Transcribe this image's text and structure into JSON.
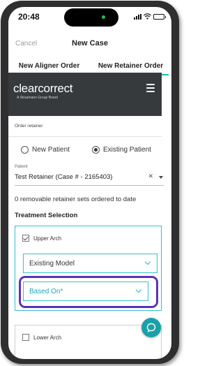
{
  "status_bar": {
    "time": "20:48",
    "icons": [
      "signal-icon",
      "wifi-icon",
      "battery-icon"
    ]
  },
  "nav": {
    "cancel_label": "Cancel",
    "title": "New Case"
  },
  "tabs": [
    {
      "label": "New Aligner Order",
      "active": false
    },
    {
      "label": "New Retainer Order",
      "active": true
    }
  ],
  "brand": {
    "logo_text": "clearcorrect",
    "tagline": "A Straumann Group Brand",
    "menu_icon": "hamburger-menu-icon"
  },
  "form": {
    "section_label": "Order retainer",
    "patient_type_options": [
      {
        "label": "New Patient",
        "selected": false
      },
      {
        "label": "Existing Patient",
        "selected": true
      }
    ],
    "patient_field_label": "Patient",
    "patient_value": "Test Retainer (Case # - 2165403)",
    "retainer_note": "0 removable retainer sets ordered to date",
    "treatment_heading": "Treatment Selection",
    "upper_arch": {
      "label": "Upper Arch",
      "checked": true,
      "model_select": "Existing Model",
      "based_on_select": "Based On*"
    },
    "lower_arch": {
      "label": "Lower Arch",
      "checked": false
    }
  },
  "colors": {
    "accent": "#1fb6c1",
    "brand_bar": "#363a3d",
    "highlight": "#5a34b8",
    "chat_button": "#1aa0a8"
  }
}
